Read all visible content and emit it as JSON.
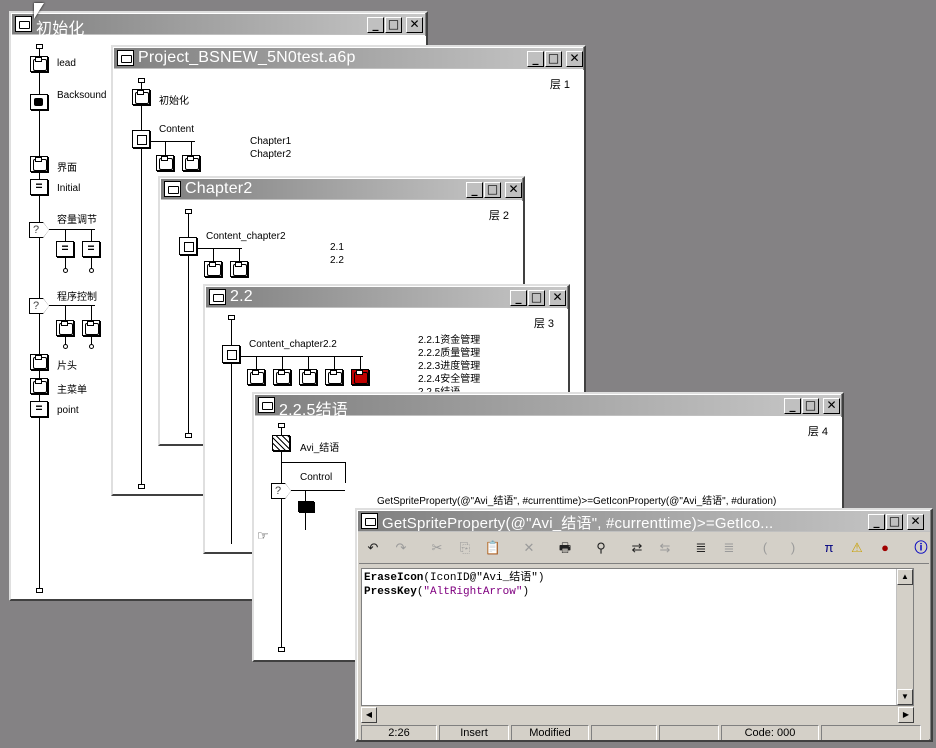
{
  "win_init": {
    "title": "初始化",
    "labels": [
      "lead",
      "Backsound",
      "界面",
      "Initial",
      "容量调节",
      "程序控制",
      "片头",
      "主菜单",
      "point"
    ]
  },
  "win_project": {
    "title": "Project_BSNEW_5N0test.a6p",
    "level": "层 1",
    "items": [
      "初始化",
      "Content",
      "Chapter1",
      "Chapter2"
    ]
  },
  "win_chapter2": {
    "title": "Chapter2",
    "level": "层 2",
    "items": [
      "Content_chapter2",
      "2.1",
      "2.2"
    ]
  },
  "win_22": {
    "title": "2.2",
    "level": "层 3",
    "items": [
      "Content_chapter2.2",
      "2.2.1资金管理",
      "2.2.2质量管理",
      "2.2.3进度管理",
      "2.2.4安全管理",
      "2.2.5结语"
    ]
  },
  "win_225": {
    "title": "2.2.5结语",
    "level": "层 4",
    "items": [
      "Avi_结语",
      "Control",
      "GetSpriteProperty(@\"Avi_结语\", #currenttime)>=GetIconProperty(@\"Avi_结语\", #duration)"
    ]
  },
  "script": {
    "title": "GetSpriteProperty(@\"Avi_结语\", #currenttime)>=GetIco...",
    "line1_kw": "EraseIcon",
    "line1_rest": "(IconID@\"Avi_结语\")",
    "line2_kw": "PressKey",
    "line2_open": "(",
    "line2_str": "\"AltRightArrow\"",
    "line2_close": ")",
    "status": {
      "pos": "2:26",
      "mode": "Insert",
      "modified": "Modified",
      "code": "Code: 000"
    }
  },
  "toolbar": [
    "undo-icon",
    "redo-icon",
    "cut-icon",
    "copy-icon",
    "paste-icon",
    "delete-icon",
    "print-icon",
    "find-icon",
    "indent-icon",
    "outdent-icon",
    "comment-icon",
    "uncomment-icon",
    "paren-open-icon",
    "paren-close-icon",
    "pi-icon",
    "warning-icon",
    "record-icon",
    "info-icon"
  ]
}
